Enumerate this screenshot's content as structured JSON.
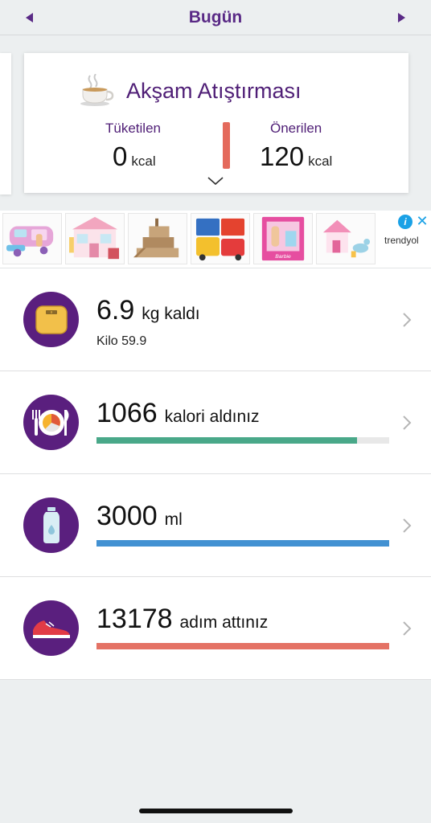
{
  "header": {
    "title": "Bugün"
  },
  "meal_card": {
    "title": "Akşam Atıştırması",
    "consumed_label": "Tüketilen",
    "consumed_value": "0",
    "consumed_unit": "kcal",
    "recommended_label": "Önerilen",
    "recommended_value": "120",
    "recommended_unit": "kcal"
  },
  "ad": {
    "brand": "trendyol",
    "info_symbol": "i",
    "close_symbol": "✕",
    "tiles": [
      "camper-toy",
      "dollhouse-toy",
      "parking-garage-toy",
      "toy-cars",
      "barbie-playset",
      "pony-stable-toy"
    ]
  },
  "summary": {
    "weight": {
      "value": "6.9",
      "text": "kg kaldı",
      "sub": "Kilo 59.9",
      "icon": "scale-icon"
    },
    "calories": {
      "value": "1066",
      "text": "kalori aldınız",
      "progress": 0.89,
      "color": "#49a889",
      "icon": "plate-icon"
    },
    "water": {
      "value": "3000",
      "text": "ml",
      "progress": 1.0,
      "color": "#4291d2",
      "icon": "water-bottle-icon"
    },
    "steps": {
      "value": "13178",
      "text": "adım attınız",
      "progress": 1.0,
      "color": "#e47265",
      "icon": "sneaker-icon"
    }
  },
  "colors": {
    "accent": "#5a2a86",
    "icon_circle": "#5a1f7e",
    "meal_divider": "#e46a5c"
  }
}
